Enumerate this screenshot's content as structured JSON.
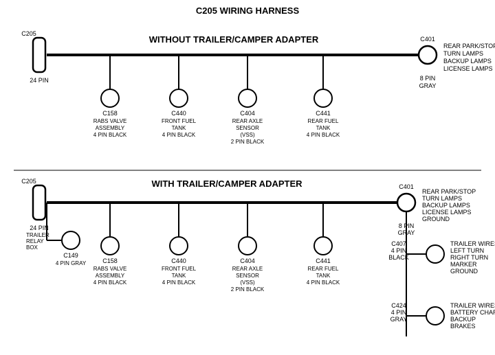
{
  "title": "C205 WIRING HARNESS",
  "top_section": {
    "label": "WITHOUT TRAILER/CAMPER ADAPTER",
    "left_connector": {
      "id": "C205",
      "pins": "24 PIN"
    },
    "right_connector": {
      "id": "C401",
      "pins": "8 PIN",
      "color": "GRAY",
      "description": [
        "REAR PARK/STOP",
        "TURN LAMPS",
        "BACKUP LAMPS",
        "LICENSE LAMPS"
      ]
    },
    "connectors": [
      {
        "id": "C158",
        "lines": [
          "RABS VALVE",
          "ASSEMBLY",
          "4 PIN BLACK"
        ]
      },
      {
        "id": "C440",
        "lines": [
          "FRONT FUEL",
          "TANK",
          "4 PIN BLACK"
        ]
      },
      {
        "id": "C404",
        "lines": [
          "REAR AXLE",
          "SENSOR",
          "(VSS)",
          "2 PIN BLACK"
        ]
      },
      {
        "id": "C441",
        "lines": [
          "REAR FUEL",
          "TANK",
          "4 PIN BLACK"
        ]
      }
    ]
  },
  "bottom_section": {
    "label": "WITH TRAILER/CAMPER ADAPTER",
    "left_connector": {
      "id": "C205",
      "pins": "24 PIN"
    },
    "extra_connector": {
      "label": "TRAILER\nRELAY\nBOX",
      "id": "C149",
      "pins": "4 PIN GRAY"
    },
    "right_connector": {
      "id": "C401",
      "pins": "8 PIN",
      "color": "GRAY",
      "description": [
        "REAR PARK/STOP",
        "TURN LAMPS",
        "BACKUP LAMPS",
        "LICENSE LAMPS",
        "GROUND"
      ]
    },
    "connectors": [
      {
        "id": "C158",
        "lines": [
          "RABS VALVE",
          "ASSEMBLY",
          "4 PIN BLACK"
        ]
      },
      {
        "id": "C440",
        "lines": [
          "FRONT FUEL",
          "TANK",
          "4 PIN BLACK"
        ]
      },
      {
        "id": "C404",
        "lines": [
          "REAR AXLE",
          "SENSOR",
          "(VSS)",
          "2 PIN BLACK"
        ]
      },
      {
        "id": "C441",
        "lines": [
          "REAR FUEL",
          "TANK",
          "4 PIN BLACK"
        ]
      }
    ],
    "right_side_connectors": [
      {
        "id": "C407",
        "pins": "4 PIN",
        "color": "BLACK",
        "lines": [
          "TRAILER WIRES",
          "LEFT TURN",
          "RIGHT TURN",
          "MARKER",
          "GROUND"
        ]
      },
      {
        "id": "C424",
        "pins": "4 PIN",
        "color": "GRAY",
        "lines": [
          "TRAILER WIRES",
          "BATTERY CHARGE",
          "BACKUP",
          "BRAKES"
        ]
      }
    ]
  }
}
